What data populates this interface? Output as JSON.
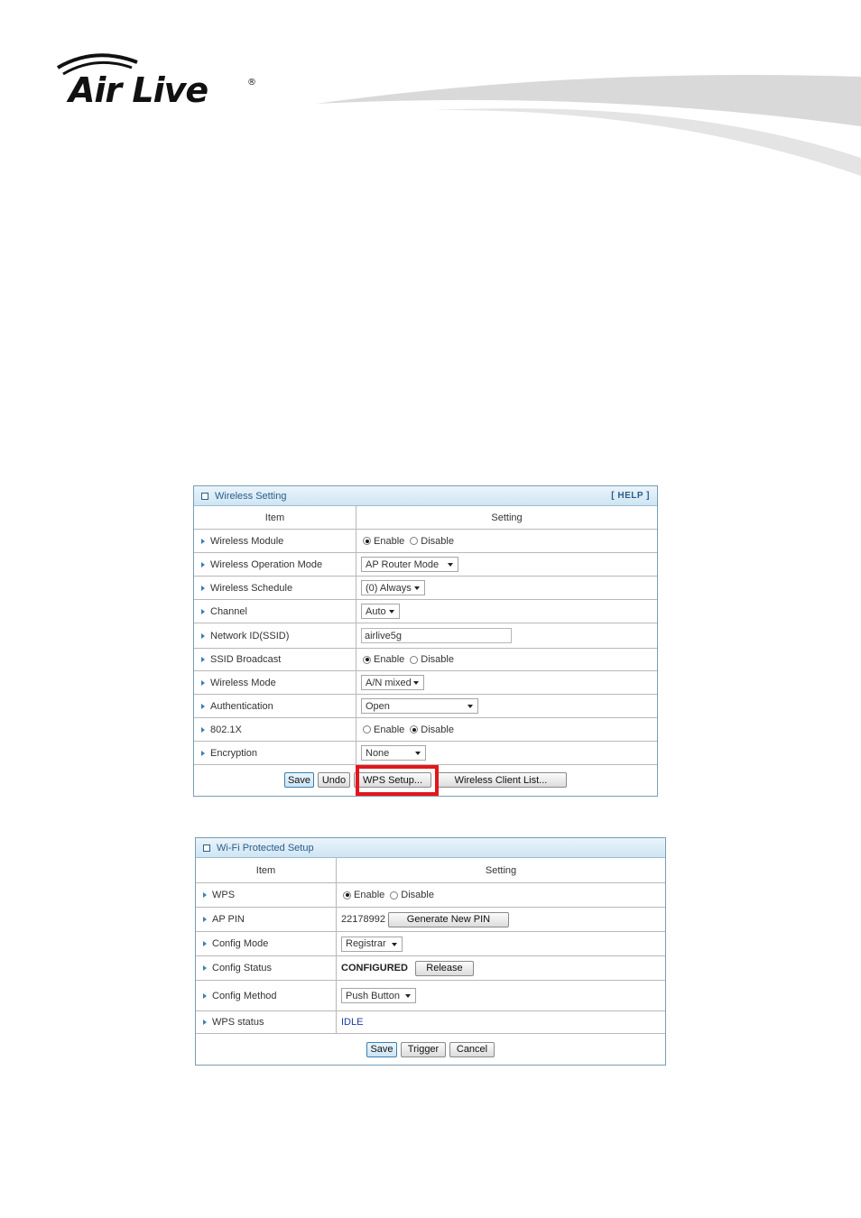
{
  "brand": {
    "logo_text": "Air Live",
    "registered_mark": "®"
  },
  "wireless_setting": {
    "title": "Wireless Setting",
    "help": "[ HELP ]",
    "header": {
      "item": "Item",
      "setting": "Setting"
    },
    "rows": {
      "wireless_module": {
        "label": "Wireless Module",
        "enable": "Enable",
        "disable": "Disable",
        "selected": "enable"
      },
      "operation_mode": {
        "label": "Wireless Operation Mode",
        "value": "AP Router Mode"
      },
      "schedule": {
        "label": "Wireless Schedule",
        "value": "(0) Always"
      },
      "channel": {
        "label": "Channel",
        "value": "Auto"
      },
      "ssid": {
        "label": "Network ID(SSID)",
        "value": "airlive5g"
      },
      "ssid_broadcast": {
        "label": "SSID Broadcast",
        "enable": "Enable",
        "disable": "Disable",
        "selected": "enable"
      },
      "wireless_mode": {
        "label": "Wireless Mode",
        "value": "A/N mixed"
      },
      "authentication": {
        "label": "Authentication",
        "value": "Open"
      },
      "dot1x": {
        "label": "802.1X",
        "enable": "Enable",
        "disable": "Disable",
        "selected": "disable"
      },
      "encryption": {
        "label": "Encryption",
        "value": "None"
      }
    },
    "buttons": {
      "save": "Save",
      "undo": "Undo",
      "wps_setup": "WPS Setup...",
      "client_list": "Wireless Client List..."
    }
  },
  "wps": {
    "title": "Wi-Fi Protected Setup",
    "header": {
      "item": "Item",
      "setting": "Setting"
    },
    "rows": {
      "wps": {
        "label": "WPS",
        "enable": "Enable",
        "disable": "Disable",
        "selected": "enable"
      },
      "ap_pin": {
        "label": "AP PIN",
        "value": "22178992",
        "button": "Generate New PIN"
      },
      "config_mode": {
        "label": "Config Mode",
        "value": "Registrar"
      },
      "config_status": {
        "label": "Config Status",
        "value": "CONFIGURED",
        "button": "Release"
      },
      "config_method": {
        "label": "Config Method",
        "value": "Push Button"
      },
      "wps_status": {
        "label": "WPS status",
        "value": "IDLE"
      }
    },
    "buttons": {
      "save": "Save",
      "trigger": "Trigger",
      "cancel": "Cancel"
    }
  },
  "colors": {
    "panel_border": "#7a9db3",
    "title_text": "#2a5d8a",
    "highlight": "#e3161c",
    "status_blue": "#1a3fa8"
  }
}
